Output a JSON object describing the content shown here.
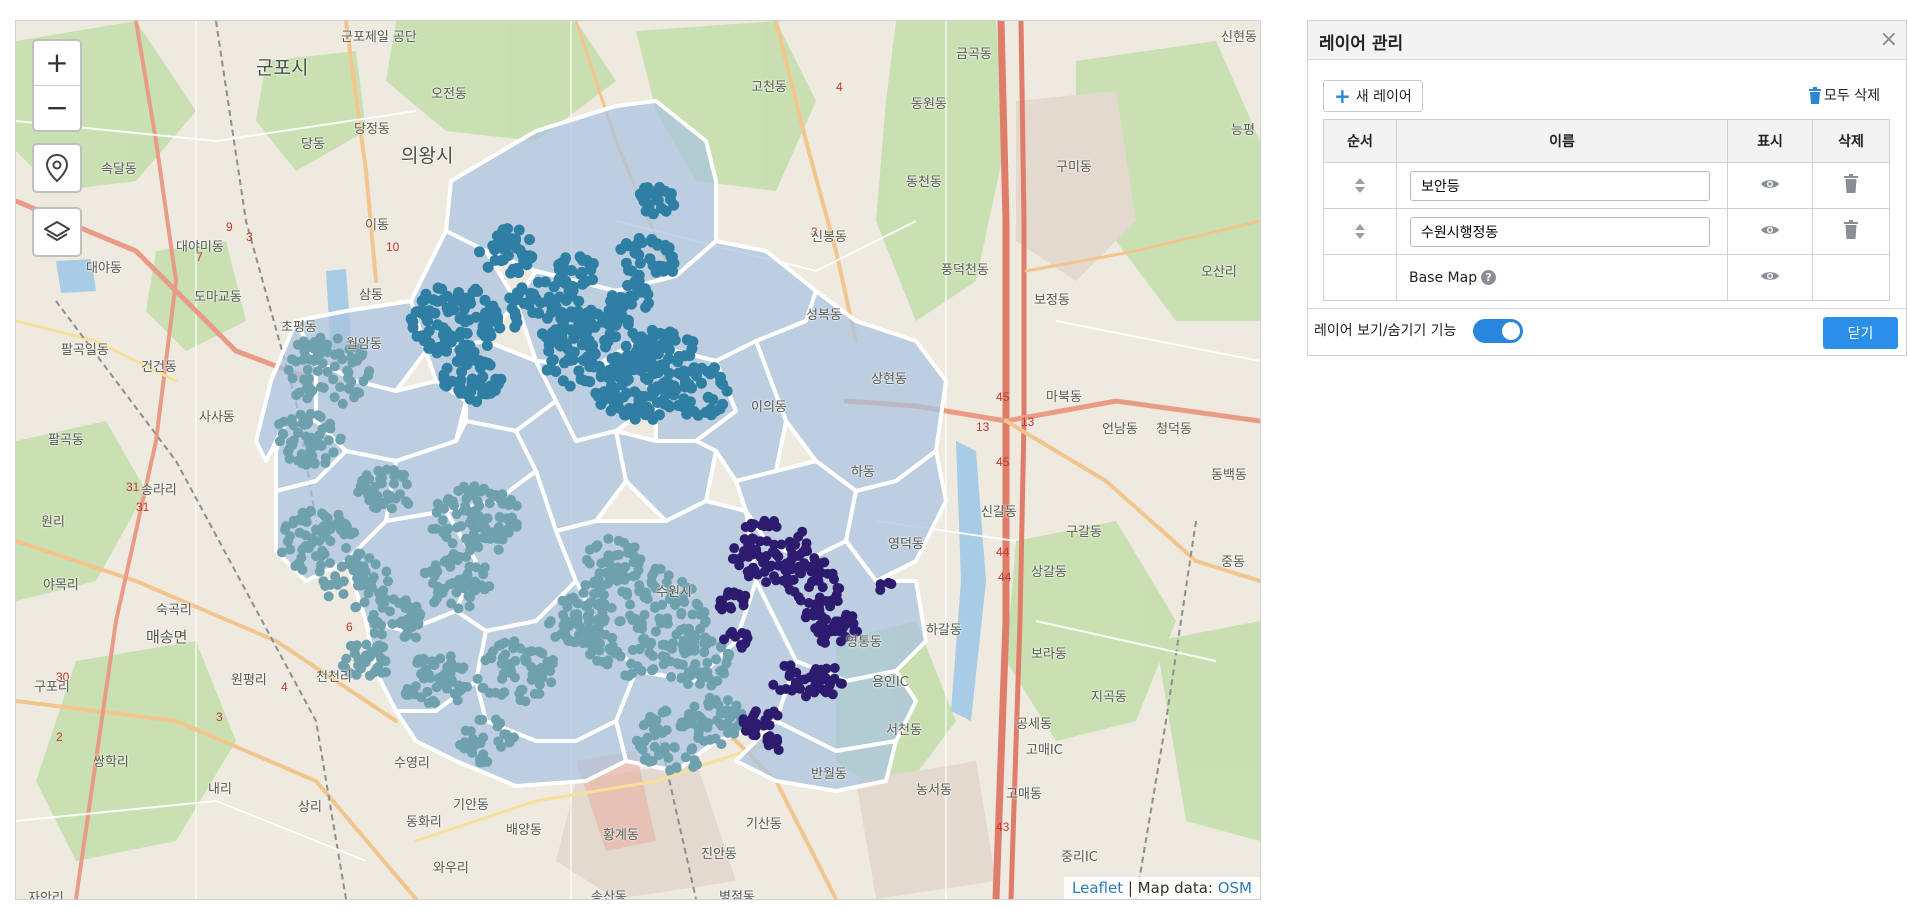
{
  "map": {
    "zoom_in_label": "+",
    "zoom_out_label": "−",
    "locate_icon": "map-pin-icon",
    "layers_icon": "stack-layers-icon",
    "attribution_leaflet": "Leaflet",
    "attribution_sep": " | Map data: ",
    "attribution_osm": "OSM",
    "colors": {
      "district_fill": "#a9c4df",
      "points_teal": "#6fa0ad",
      "points_blue": "#2f7ea3",
      "points_purple": "#2c1b6e"
    },
    "labels": [
      {
        "id": "gunpo",
        "text": "군포시",
        "size": "big"
      },
      {
        "id": "uiwang",
        "text": "의왕시",
        "size": "big"
      },
      {
        "id": "maesong",
        "text": "매송면",
        "size": "md"
      },
      {
        "id": "gongdan",
        "text": "군포제일 공단"
      },
      {
        "id": "ojeon",
        "text": "오전동"
      },
      {
        "id": "godeung",
        "text": "고천동"
      },
      {
        "id": "geumgok",
        "text": "금곡동"
      },
      {
        "id": "dongwon",
        "text": "동원동"
      },
      {
        "id": "dongcheon",
        "text": "동천동"
      },
      {
        "id": "sinbong",
        "text": "신봉동"
      },
      {
        "id": "seongbok",
        "text": "성복동"
      },
      {
        "id": "sanghyeon",
        "text": "상현동"
      },
      {
        "id": "pungdeok",
        "text": "풍덕천동"
      },
      {
        "id": "bojeong",
        "text": "보정동"
      },
      {
        "id": "mabuk",
        "text": "마북동"
      },
      {
        "id": "eonnam",
        "text": "언남동"
      },
      {
        "id": "cheongdeok",
        "text": "청덕동"
      },
      {
        "id": "singal",
        "text": "신갈동"
      },
      {
        "id": "gugal",
        "text": "구갈동"
      },
      {
        "id": "sanggal",
        "text": "상갈동"
      },
      {
        "id": "yeongdeok",
        "text": "영덕동"
      },
      {
        "id": "hagal",
        "text": "하갈동"
      },
      {
        "id": "ha",
        "text": "하동"
      },
      {
        "id": "ieui",
        "text": "이의동"
      },
      {
        "id": "yeongtong",
        "text": "영통동"
      },
      {
        "id": "seocheon",
        "text": "서천동"
      },
      {
        "id": "bora",
        "text": "보라동"
      },
      {
        "id": "jigok",
        "text": "지곡동"
      },
      {
        "id": "gongse",
        "text": "공세동"
      },
      {
        "id": "gomae",
        "text": "고매동"
      },
      {
        "id": "nongseo",
        "text": "농서동"
      },
      {
        "id": "banwol",
        "text": "반월동"
      },
      {
        "id": "gisan",
        "text": "기산동"
      },
      {
        "id": "jinan",
        "text": "진안동"
      },
      {
        "id": "byeongjeom",
        "text": "병점동"
      },
      {
        "id": "songsan",
        "text": "송산동"
      },
      {
        "id": "hwanggye",
        "text": "황계동"
      },
      {
        "id": "baeyang",
        "text": "배양동"
      },
      {
        "id": "gian",
        "text": "기안동"
      },
      {
        "id": "suyeong",
        "text": "수영리"
      },
      {
        "id": "donghwa",
        "text": "동화리"
      },
      {
        "id": "wau",
        "text": "와우리"
      },
      {
        "id": "jaan",
        "text": "자안리"
      },
      {
        "id": "sangri",
        "text": "상리"
      },
      {
        "id": "naeri",
        "text": "내리"
      },
      {
        "id": "ssanghak",
        "text": "쌍학리"
      },
      {
        "id": "gupo",
        "text": "구포리"
      },
      {
        "id": "wonpyeong",
        "text": "원평리"
      },
      {
        "id": "cheoncheon",
        "text": "천천리"
      },
      {
        "id": "suksong",
        "text": "숙곡리"
      },
      {
        "id": "yamok",
        "text": "야목리"
      },
      {
        "id": "wonri",
        "text": "원리"
      },
      {
        "id": "songra",
        "text": "송라리"
      },
      {
        "id": "palgok",
        "text": "팔곡동"
      },
      {
        "id": "palgogil",
        "text": "팔곡일동"
      },
      {
        "id": "geongeon",
        "text": "건건동"
      },
      {
        "id": "sasa",
        "text": "사사동"
      },
      {
        "id": "domabyo",
        "text": "도마교동"
      },
      {
        "id": "daeyami",
        "text": "대야미동"
      },
      {
        "id": "chopyeong",
        "text": "초평동"
      },
      {
        "id": "wolam",
        "text": "월암동"
      },
      {
        "id": "samdong",
        "text": "삼동"
      },
      {
        "id": "idong",
        "text": "이동"
      },
      {
        "id": "dangjeong",
        "text": "당정동"
      },
      {
        "id": "sokdal",
        "text": "속달동"
      },
      {
        "id": "daeya",
        "text": "대야동"
      },
      {
        "id": "danggok",
        "text": "당동"
      },
      {
        "id": "gumi",
        "text": "구미동"
      },
      {
        "id": "osan",
        "text": "오산리"
      },
      {
        "id": "jung",
        "text": "중동"
      },
      {
        "id": "dongbaek",
        "text": "동백동"
      },
      {
        "id": "nongbyeong",
        "text": "능평"
      },
      {
        "id": "sinhyeon",
        "text": "신현동"
      },
      {
        "id": "suwon",
        "text": "수원시"
      },
      {
        "id": "yonginic",
        "text": "용인IC"
      },
      {
        "id": "gomaeic",
        "text": "고매IC"
      },
      {
        "id": "jungriic",
        "text": "중리IC"
      }
    ]
  },
  "panel": {
    "title": "레이어 관리",
    "close_symbol": "×",
    "new_layer_label": "새 레이어",
    "delete_all_label": "모두 삭제",
    "columns": {
      "order": "순서",
      "name": "이름",
      "visible": "표시",
      "delete": "삭제"
    },
    "layers": [
      {
        "name": "보안등"
      },
      {
        "name": "수원시행정동"
      }
    ],
    "base_map_label": "Base Map",
    "help_symbol": "?",
    "toggle_label": "레이어 보기/숨기기 기능",
    "toggle_on": true,
    "close_button_label": "닫기"
  }
}
